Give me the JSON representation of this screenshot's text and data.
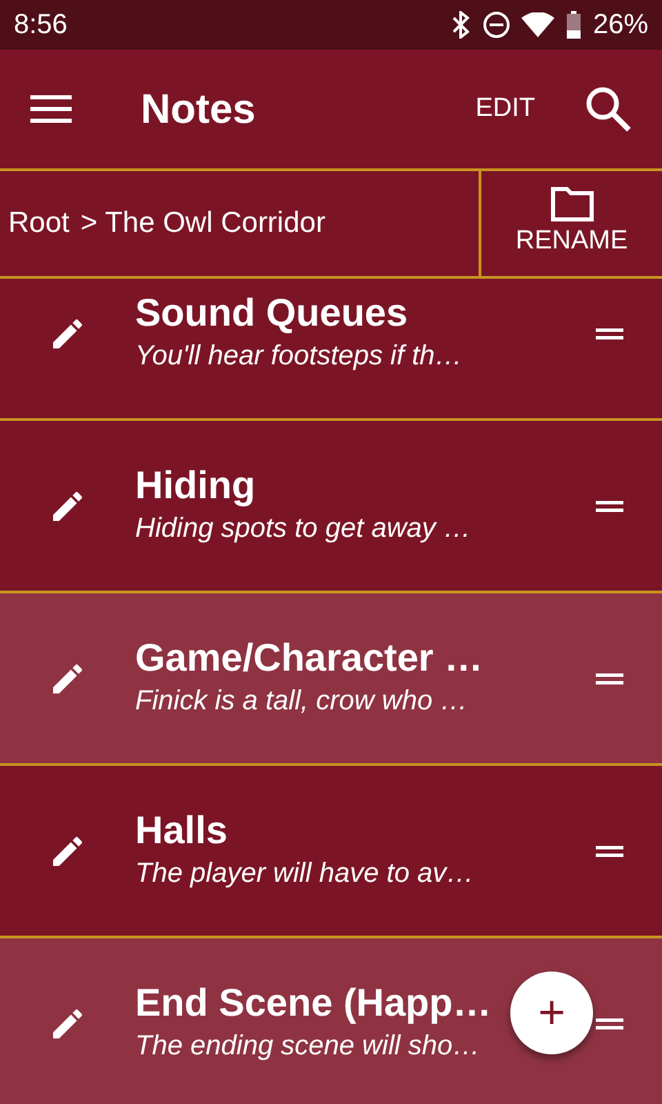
{
  "status_bar": {
    "time": "8:56",
    "battery": "26%"
  },
  "app_bar": {
    "title": "Notes",
    "action": "EDIT"
  },
  "breadcrumb": {
    "path": [
      "Root",
      "> The Owl Corridor"
    ],
    "button": "RENAME"
  },
  "notes": [
    {
      "title": "Sound Queues",
      "preview": "You'll hear footsteps if th…",
      "color": "#7b1526"
    },
    {
      "title": "Hiding",
      "preview": "Hiding spots to get away …",
      "color": "#7b1526"
    },
    {
      "title": "Game/Character …",
      "preview": "Finick is a tall, crow who …",
      "color": "#8f3343"
    },
    {
      "title": "Halls",
      "preview": "The player will have to av…",
      "color": "#7b1526"
    },
    {
      "title": "End Scene (Happ…",
      "preview": "The ending scene will sho…",
      "color": "#8f3343"
    }
  ],
  "fab": {
    "label": "+"
  }
}
